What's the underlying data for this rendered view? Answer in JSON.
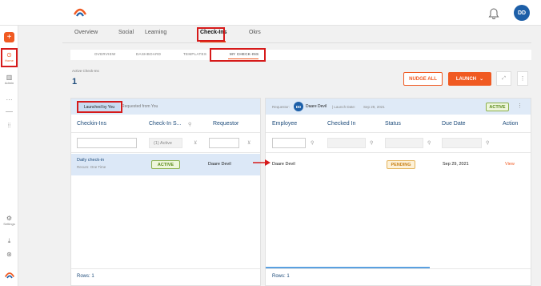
{
  "header": {
    "avatar_initials": "DD"
  },
  "sidebar": {
    "home_label": "Home",
    "admin_label": "Admin",
    "settings_label": "Settings",
    "more_icon": "ellipsis-icon"
  },
  "tabs": [
    "Overview",
    "Social",
    "Learning",
    "Check-Ins",
    "Okrs"
  ],
  "subtabs": [
    "OVERVIEW",
    "DASHBOARD",
    "TEMPLATES",
    "MY CHECK-INS"
  ],
  "active_checkins": {
    "label": "Active Check-Ins",
    "count": "1"
  },
  "actions": {
    "nudge": "NUDGE ALL",
    "launch": "LAUNCH",
    "launch_caret": "⌄",
    "more": "⋮"
  },
  "left_panel": {
    "segment_active": "Launched by You",
    "segment_other": "Requested from You",
    "columns": [
      "Checkin-Ins",
      "Check-In S...",
      "Requestor"
    ],
    "status_filter": "(1) Active",
    "row": {
      "title": "Daily check-in",
      "recurs": "Recurs: One Time",
      "status": "ACTIVE",
      "requestor": "Daare Devil"
    },
    "rows_label": "Rows: 1"
  },
  "right_panel": {
    "requestor_label": "Requestor:",
    "requestor_initials": "DD",
    "requestor_name": "Daare Devil",
    "launch_label": "| Launch Date:",
    "launch_date": "Sep 29, 2021",
    "status_badge": "ACTIVE",
    "more": "⋮",
    "columns": [
      "Employee",
      "Checked In",
      "Status",
      "Due Date",
      "Action"
    ],
    "row": {
      "employee": "Daare Devil",
      "status": "PENDING",
      "due_date": "Sep 29, 2021",
      "action": "View"
    },
    "rows_label": "Rows: 1"
  },
  "colors": {
    "accent": "#f05a22",
    "navy": "#1d4b7a",
    "highlight": "#d61a1a"
  }
}
